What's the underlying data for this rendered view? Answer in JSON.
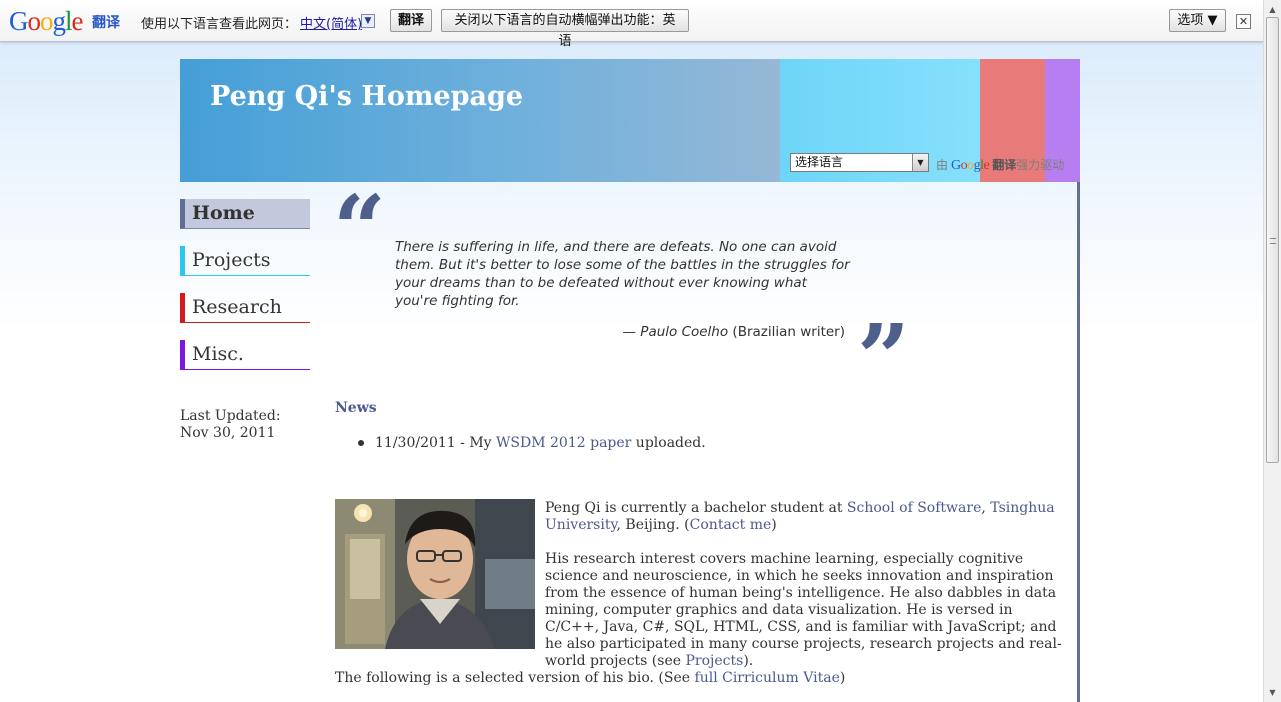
{
  "translate_bar": {
    "logo_parts": [
      "G",
      "o",
      "o",
      "g",
      "l",
      "e"
    ],
    "translate_label": "翻译",
    "prompt": "使用以下语言查看此网页：",
    "language_link": "中文(简体)",
    "dropdown_glyph": "▼",
    "translate_button": "翻译",
    "close_auto_button": "关闭以下语言的自动横幅弹出功能：英语",
    "options_button": "选项 ▼",
    "close_glyph": "✕"
  },
  "header": {
    "title": "Peng Qi's Homepage",
    "language_select_value": "选择语言",
    "powered_prefix": "由",
    "powered_brand": "Google",
    "powered_translate": "翻译",
    "powered_suffix": "强力驱动",
    "colors": {
      "main": "#449fd6",
      "cyan": "#6ed5f8",
      "red": "#e87b79",
      "purple": "#b77ef2"
    }
  },
  "nav": {
    "home": "Home",
    "projects": "Projects",
    "research": "Research",
    "misc": "Misc."
  },
  "last_updated": {
    "label": "Last Updated:",
    "date": "Nov 30, 2011"
  },
  "quote": {
    "open_mark": "“",
    "close_mark": "”",
    "text": "There is suffering in life, and there are defeats. No one can avoid them. But it's better to lose some of the battles in the struggles for your dreams than to be defeated without ever knowing what you're fighting for.",
    "dash": "— ",
    "author": "Paulo Coelho",
    "author_note": " (Brazilian writer)"
  },
  "news": {
    "heading": "News",
    "item_prefix": "11/30/2011 - My ",
    "item_link": "WSDM 2012 paper",
    "item_suffix": " uploaded."
  },
  "bio": {
    "p1_a": "Peng Qi is currently a bachelor student at ",
    "p1_link1": "School of Software",
    "p1_b": ", ",
    "p1_link2": "Tsinghua University",
    "p1_c": ", Beijing. (",
    "p1_link3": "Contact me",
    "p1_d": ")",
    "p2_text": "His research interest covers machine learning, especially cognitive science and neuroscience, in which he seeks innovation and inspiration from the essence of human being's intelligence. He also dabbles in data mining, computer graphics and data visualization. He is versed in C/C++, Java, C#, SQL, HTML, CSS, and is familiar with JavaScript; and he also participated in many course projects, research projects and real-world projects (see ",
    "p2_link": "Projects",
    "p2_end": ").",
    "p3_text": "The following is a selected version of his bio. (See ",
    "p3_link": "full Cirriculum Vitae",
    "p3_end": ")"
  },
  "scrollbar": {
    "up": "▲",
    "down": "▼"
  }
}
